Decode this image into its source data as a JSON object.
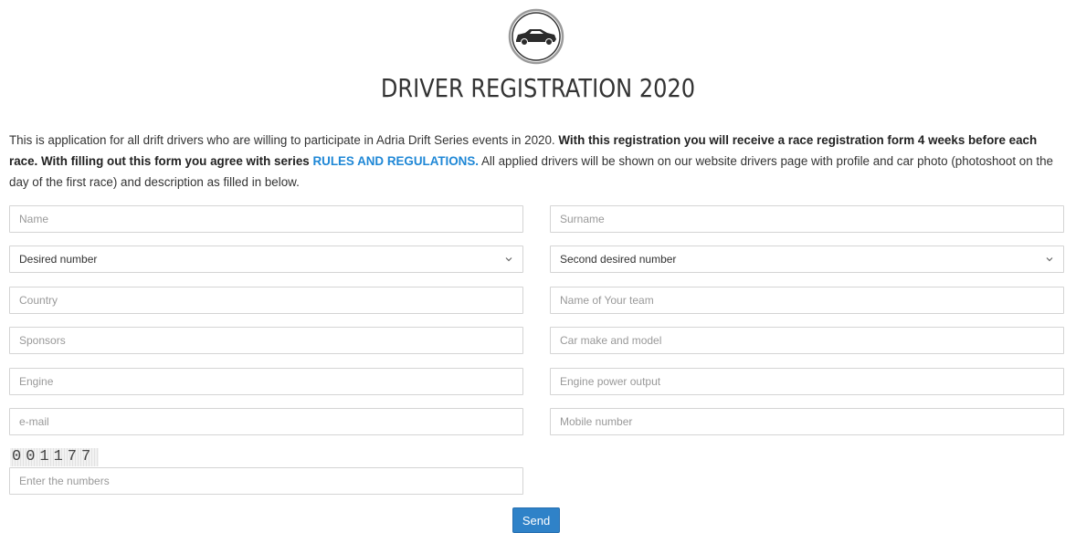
{
  "header": {
    "logo_icon": "race-car-icon",
    "title": "DRIVER REGISTRATION 2020"
  },
  "intro": {
    "text_1": "This is application for all drift drivers who are willing to participate in Adria Drift Series events in 2020. ",
    "bold_1": "With this registration you will receive a race registration form 4 weeks before each race. With filling out this form you agree with series ",
    "link": "RULES AND REGULATIONS.",
    "text_2": " All applied drivers will be shown on our website drivers page with profile and car photo (photoshoot on the day of the first race) and description as filled in below."
  },
  "form": {
    "name_placeholder": "Name",
    "surname_placeholder": "Surname",
    "desired_number": "Desired number",
    "second_desired_number": "Second desired number",
    "country_placeholder": "Country",
    "team_placeholder": "Name of Your team",
    "sponsors_placeholder": "Sponsors",
    "car_placeholder": "Car make and model",
    "engine_placeholder": "Engine",
    "power_placeholder": "Engine power output",
    "email_placeholder": "e-mail",
    "mobile_placeholder": "Mobile number",
    "captcha_code": "001177",
    "captcha_placeholder": "Enter the numbers",
    "send_label": "Send"
  }
}
